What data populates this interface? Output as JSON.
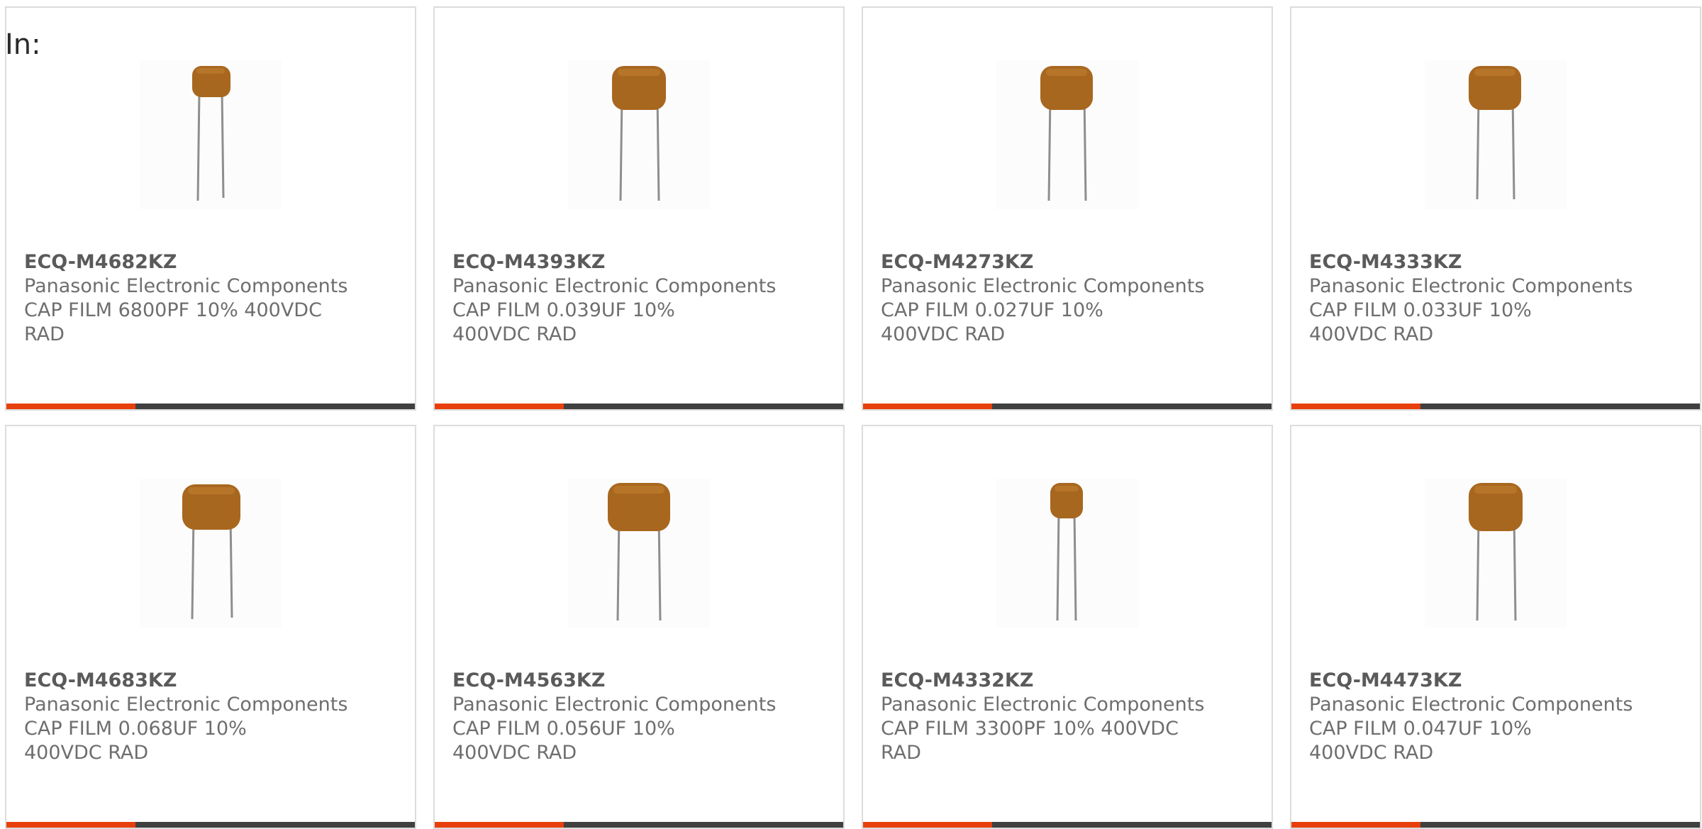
{
  "page": {
    "filter_label": "In:"
  },
  "theme": {
    "accent": "#e8400c",
    "bar_dark": "#404040",
    "card_border": "#dcdcdc",
    "capacitor_body": "#a8671f"
  },
  "products": [
    {
      "part_number": "ECQ-M4682KZ",
      "manufacturer": "Panasonic Electronic Components",
      "description": "CAP FILM 6800PF 10% 400VDC RAD",
      "image": "capacitor-photo"
    },
    {
      "part_number": "ECQ-M4393KZ",
      "manufacturer": "Panasonic Electronic Components",
      "description": "CAP FILM 0.039UF 10% 400VDC RAD",
      "image": "capacitor-photo"
    },
    {
      "part_number": "ECQ-M4273KZ",
      "manufacturer": "Panasonic Electronic Components",
      "description": "CAP FILM 0.027UF 10% 400VDC RAD",
      "image": "capacitor-photo"
    },
    {
      "part_number": "ECQ-M4333KZ",
      "manufacturer": "Panasonic Electronic Components",
      "description": "CAP FILM 0.033UF 10% 400VDC RAD",
      "image": "capacitor-photo"
    },
    {
      "part_number": "ECQ-M4683KZ",
      "manufacturer": "Panasonic Electronic Components",
      "description": "CAP FILM 0.068UF 10% 400VDC RAD",
      "image": "capacitor-photo"
    },
    {
      "part_number": "ECQ-M4563KZ",
      "manufacturer": "Panasonic Electronic Components",
      "description": "CAP FILM 0.056UF 10% 400VDC RAD",
      "image": "capacitor-photo"
    },
    {
      "part_number": "ECQ-M4332KZ",
      "manufacturer": "Panasonic Electronic Components",
      "description": "CAP FILM 3300PF 10% 400VDC RAD",
      "image": "capacitor-photo"
    },
    {
      "part_number": "ECQ-M4473KZ",
      "manufacturer": "Panasonic Electronic Components",
      "description": "CAP FILM 0.047UF 10% 400VDC RAD",
      "image": "capacitor-photo"
    }
  ]
}
